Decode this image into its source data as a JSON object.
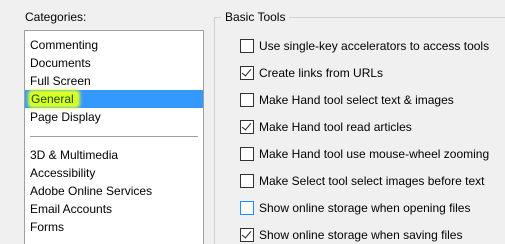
{
  "categories": {
    "label": "Categories:",
    "items_top": [
      {
        "label": "Commenting"
      },
      {
        "label": "Documents"
      },
      {
        "label": "Full Screen"
      },
      {
        "label": "General"
      },
      {
        "label": "Page Display"
      }
    ],
    "items_bottom": [
      {
        "label": "3D & Multimedia"
      },
      {
        "label": "Accessibility"
      },
      {
        "label": "Adobe Online Services"
      },
      {
        "label": "Email Accounts"
      },
      {
        "label": "Forms"
      }
    ],
    "selected": "General",
    "selection_color": "#3399ff",
    "highlight_color": "#d8ff2a"
  },
  "basic_tools": {
    "title": "Basic Tools",
    "options": [
      {
        "label": "Use single-key accelerators to access tools",
        "checked": false
      },
      {
        "label": "Create links from URLs",
        "checked": true
      },
      {
        "label": "Make Hand tool select text & images",
        "checked": false
      },
      {
        "label": "Make Hand tool read articles",
        "checked": true
      },
      {
        "label": "Make Hand tool use mouse-wheel zooming",
        "checked": false
      },
      {
        "label": "Make Select tool select images before text",
        "checked": false
      },
      {
        "label": "Show online storage when opening files",
        "checked": false,
        "focused": true
      },
      {
        "label": "Show online storage when saving files",
        "checked": true
      }
    ]
  }
}
